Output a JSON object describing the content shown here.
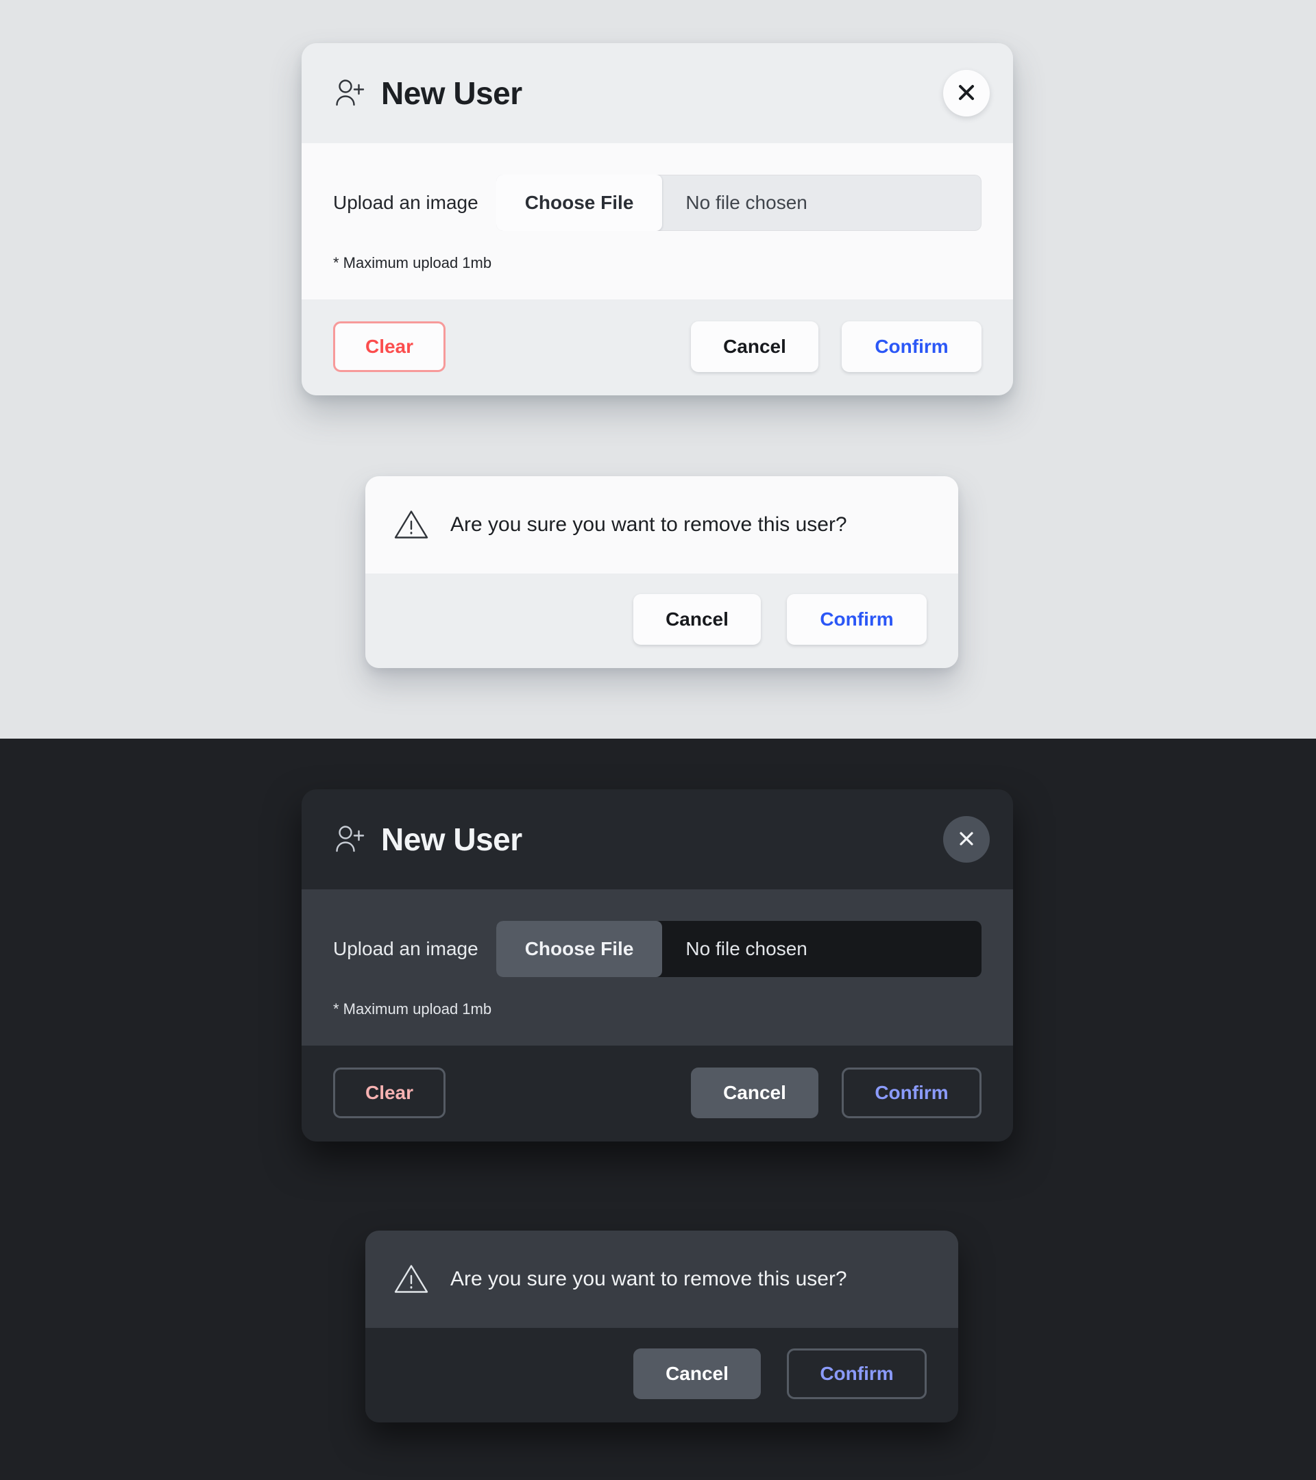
{
  "themes": {
    "light": {
      "page_background": "#e2e4e6",
      "modal": {
        "icon": "user-add-icon",
        "title": "New User",
        "close_icon": "close-icon",
        "upload_label": "Upload an image",
        "choose_file_label": "Choose File",
        "file_status": "No file chosen",
        "hint": "* Maximum upload 1mb",
        "clear_label": "Clear",
        "cancel_label": "Cancel",
        "confirm_label": "Confirm"
      },
      "dialog": {
        "icon": "warning-triangle-icon",
        "message": "Are you sure you want to remove this user?",
        "cancel_label": "Cancel",
        "confirm_label": "Confirm"
      },
      "colors": {
        "header_bg": "#eceef0",
        "body_bg": "#fafafb",
        "footer_bg": "#eceef0",
        "clear_text": "#fb4d4d",
        "clear_border": "#f79a9a",
        "cancel_text": "#17191d",
        "confirm_text": "#2b57f6"
      }
    },
    "dark": {
      "page_background": "#1f2125",
      "modal": {
        "icon": "user-add-icon",
        "title": "New User",
        "close_icon": "close-icon",
        "upload_label": "Upload an image",
        "choose_file_label": "Choose File",
        "file_status": "No file chosen",
        "hint": "* Maximum upload 1mb",
        "clear_label": "Clear",
        "cancel_label": "Cancel",
        "confirm_label": "Confirm"
      },
      "dialog": {
        "icon": "warning-triangle-icon",
        "message": "Are you sure you want to remove this user?",
        "cancel_label": "Cancel",
        "confirm_label": "Confirm"
      },
      "colors": {
        "header_bg": "#25282d",
        "body_bg": "#393d44",
        "footer_bg": "#24272c",
        "file_field_bg": "#16181b",
        "clear_text": "#f6b2b2",
        "clear_border": "#555b64",
        "cancel_bg": "#545a63",
        "cancel_text": "#ffffff",
        "confirm_text": "#8b9bfb"
      }
    }
  }
}
